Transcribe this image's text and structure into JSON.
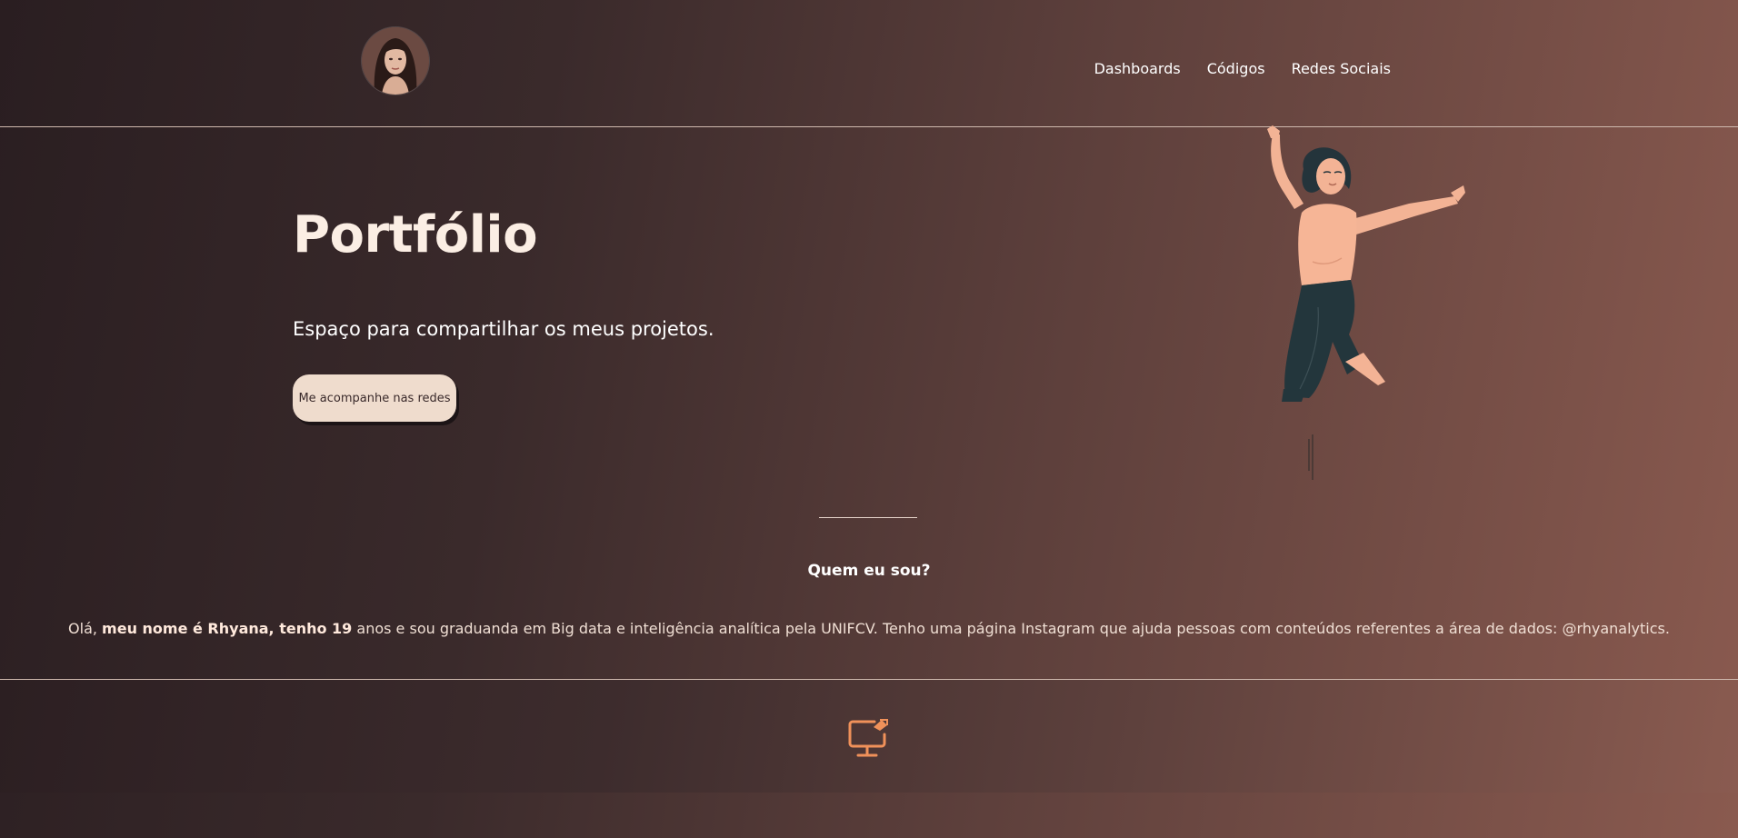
{
  "header": {
    "avatar_alt": "profile photo",
    "nav": [
      {
        "label": "Dashboards"
      },
      {
        "label": "Códigos"
      },
      {
        "label": "Redes Sociais"
      }
    ]
  },
  "hero": {
    "title": "Portfólio",
    "subtitle": "Espaço para compartilhar os meus projetos.",
    "cta_label": "Me acompanhe nas redes"
  },
  "about": {
    "heading": "Quem eu sou?",
    "text_prefix": "Olá, ",
    "text_bold": "meu nome é Rhyana, tenho 19",
    "text_suffix": " anos e sou graduanda em Big data e inteligência analítica pela UNIFCV. Tenho uma página Instagram que ajuda pessoas com conteúdos referentes a área de dados: @rhyanalytics."
  },
  "footer": {
    "icon": "monitor-icon"
  },
  "colors": {
    "accent": "#f0915a",
    "button_bg": "#efdccd",
    "text_light": "#fbeee4"
  }
}
